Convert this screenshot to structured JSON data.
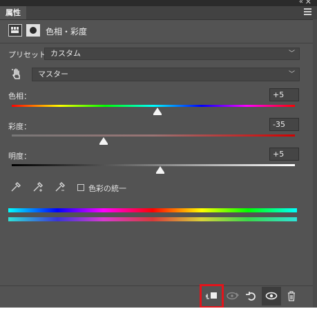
{
  "panel": {
    "tab_label": "属性",
    "collapse_glyph": "«",
    "close_glyph": "▸",
    "title": "色相・彩度",
    "header_icons": [
      "adjustment-layer-icon",
      "layer-mask-icon"
    ]
  },
  "preset": {
    "label": "プリセット：",
    "value": "カスタム"
  },
  "channel": {
    "value": "マスター"
  },
  "hue": {
    "label": "色相：",
    "value": "+5",
    "level": 5,
    "min": -180,
    "max": 180
  },
  "saturation": {
    "label": "彩度：",
    "value": "-35",
    "level": -35,
    "min": -100,
    "max": 100
  },
  "lightness": {
    "label": "明度：",
    "value": "+5",
    "level": 5,
    "min": -100,
    "max": 100
  },
  "colorize": {
    "label": "色彩の統一",
    "checked": false
  },
  "eyedroppers": [
    "eyedropper-icon",
    "eyedropper-add-icon",
    "eyedropper-subtract-icon"
  ],
  "toolbar": {
    "buttons": [
      "clip-to-layer-icon",
      "view-previous-state-icon",
      "reset-icon",
      "toggle-visibility-icon",
      "delete-icon"
    ]
  },
  "colors": {
    "panel_bg": "#535353",
    "highlight": "#e3141b"
  }
}
